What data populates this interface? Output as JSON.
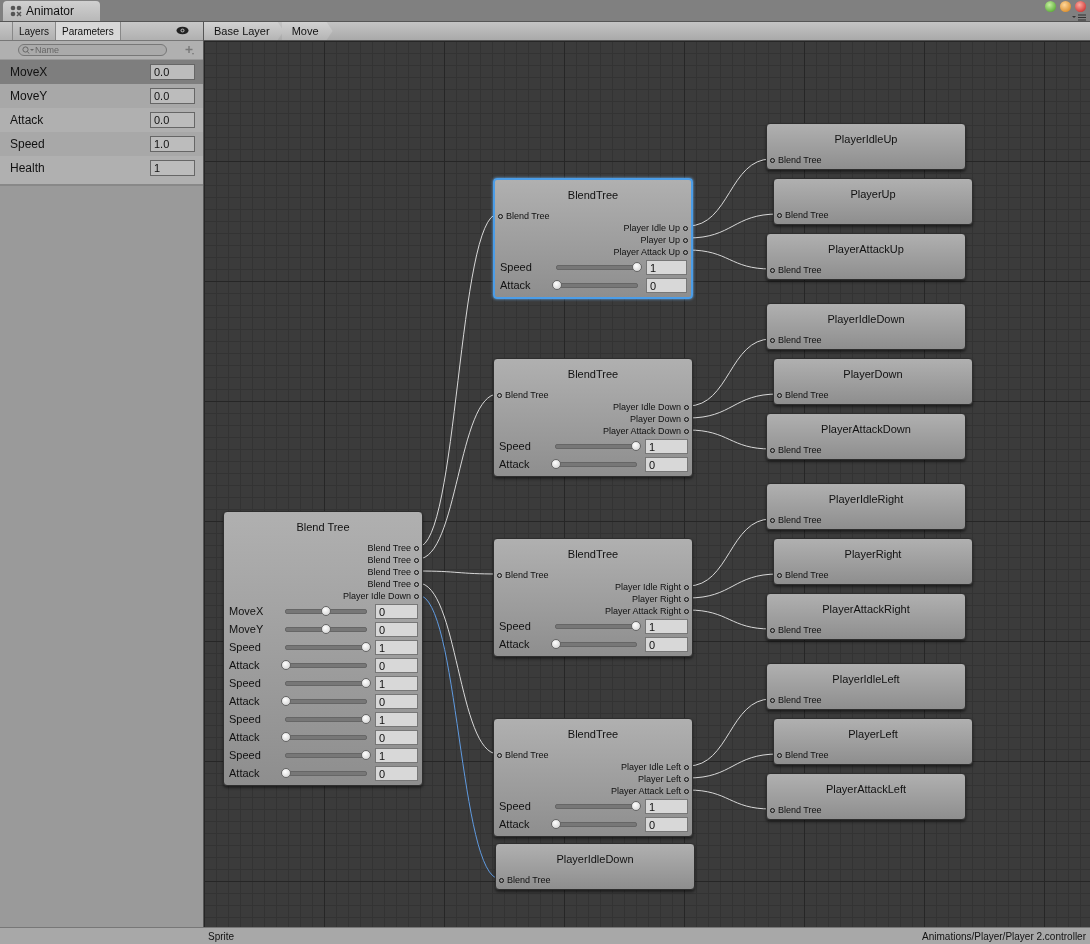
{
  "window": {
    "tab": "Animator"
  },
  "panel": {
    "tabs": [
      {
        "label": "Layers",
        "selected": false
      },
      {
        "label": "Parameters",
        "selected": true
      }
    ],
    "search": {
      "placeholder": "Name"
    },
    "parameters": [
      {
        "name": "MoveX",
        "value": "0.0",
        "selected": true
      },
      {
        "name": "MoveY",
        "value": "0.0",
        "selected": false
      },
      {
        "name": "Attack",
        "value": "0.0",
        "selected": false
      },
      {
        "name": "Speed",
        "value": "1.0",
        "selected": false
      },
      {
        "name": "Health",
        "value": "1",
        "selected": false
      }
    ]
  },
  "breadcrumb": [
    "Base Layer",
    "Move"
  ],
  "graph": {
    "nodes": [
      {
        "kind": "blend_tree",
        "title": "Blend Tree",
        "selected": false,
        "outputs": [
          "Blend Tree",
          "Blend Tree",
          "Blend Tree",
          "Blend Tree",
          "Player Idle Down"
        ],
        "parameters": [
          {
            "name": "MoveX",
            "level": 0.5,
            "value": "0"
          },
          {
            "name": "MoveY",
            "level": 0.5,
            "value": "0"
          },
          {
            "name": "Speed",
            "level": 1,
            "value": "1"
          },
          {
            "name": "Attack",
            "level": 0,
            "value": "0"
          },
          {
            "name": "Speed",
            "level": 1,
            "value": "1"
          },
          {
            "name": "Attack",
            "level": 0,
            "value": "0"
          },
          {
            "name": "Speed",
            "level": 1,
            "value": "1"
          },
          {
            "name": "Attack",
            "level": 0,
            "value": "0"
          },
          {
            "name": "Speed",
            "level": 1,
            "value": "1"
          },
          {
            "name": "Attack",
            "level": 0,
            "value": "0"
          }
        ]
      },
      {
        "kind": "blend_tree",
        "title": "BlendTree",
        "selected": true,
        "input": "Blend Tree",
        "outputs": [
          "Player Idle Up",
          "Player Up",
          "Player Attack Up"
        ],
        "parameters": [
          {
            "name": "Speed",
            "level": 1,
            "value": "1"
          },
          {
            "name": "Attack",
            "level": 0,
            "value": "0"
          }
        ]
      },
      {
        "kind": "blend_tree",
        "title": "BlendTree",
        "selected": false,
        "input": "Blend Tree",
        "outputs": [
          "Player Idle Down",
          "Player Down",
          "Player Attack Down"
        ],
        "parameters": [
          {
            "name": "Speed",
            "level": 1,
            "value": "1"
          },
          {
            "name": "Attack",
            "level": 0,
            "value": "0"
          }
        ]
      },
      {
        "kind": "blend_tree",
        "title": "BlendTree",
        "selected": false,
        "input": "Blend Tree",
        "outputs": [
          "Player Idle Right",
          "Player Right",
          "Player Attack Right"
        ],
        "parameters": [
          {
            "name": "Speed",
            "level": 1,
            "value": "1"
          },
          {
            "name": "Attack",
            "level": 0,
            "value": "0"
          }
        ]
      },
      {
        "kind": "blend_tree",
        "title": "BlendTree",
        "selected": false,
        "input": "Blend Tree",
        "outputs": [
          "Player Idle Left",
          "Player Left",
          "Player Attack Left"
        ],
        "parameters": [
          {
            "name": "Speed",
            "level": 1,
            "value": "1"
          },
          {
            "name": "Attack",
            "level": 0,
            "value": "0"
          }
        ]
      },
      {
        "kind": "state",
        "title": "PlayerIdleUp",
        "input": "Blend Tree"
      },
      {
        "kind": "state",
        "title": "PlayerUp",
        "input": "Blend Tree"
      },
      {
        "kind": "state",
        "title": "PlayerAttackUp",
        "input": "Blend Tree"
      },
      {
        "kind": "state",
        "title": "PlayerIdleDown",
        "input": "Blend Tree"
      },
      {
        "kind": "state",
        "title": "PlayerDown",
        "input": "Blend Tree"
      },
      {
        "kind": "state",
        "title": "PlayerAttackDown",
        "input": "Blend Tree"
      },
      {
        "kind": "state",
        "title": "PlayerIdleRight",
        "input": "Blend Tree"
      },
      {
        "kind": "state",
        "title": "PlayerRight",
        "input": "Blend Tree"
      },
      {
        "kind": "state",
        "title": "PlayerAttackRight",
        "input": "Blend Tree"
      },
      {
        "kind": "state",
        "title": "PlayerIdleLeft",
        "input": "Blend Tree"
      },
      {
        "kind": "state",
        "title": "PlayerLeft",
        "input": "Blend Tree"
      },
      {
        "kind": "state",
        "title": "PlayerAttackLeft",
        "input": "Blend Tree"
      },
      {
        "kind": "state",
        "title": "PlayerIdleDown",
        "input": "Blend Tree"
      }
    ]
  },
  "status_bar": {
    "left": "Sprite",
    "right": "Animations/Player/Player 2.controller"
  }
}
